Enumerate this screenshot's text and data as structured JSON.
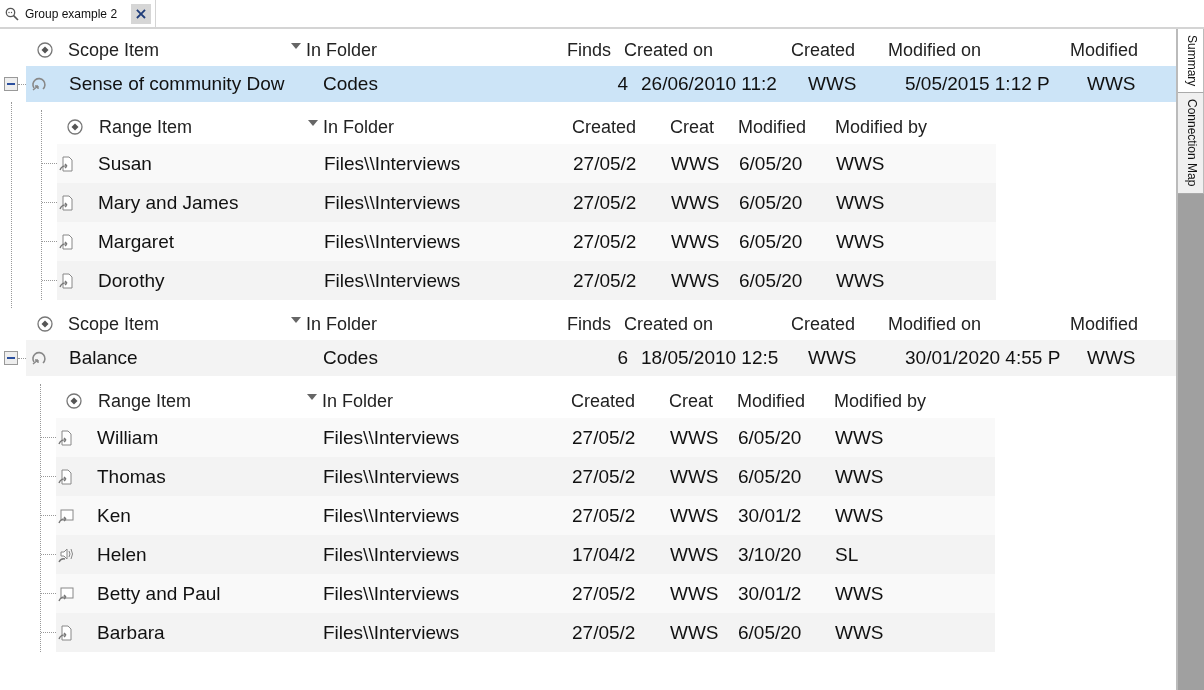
{
  "tab": {
    "title": "Group example 2",
    "close": "×"
  },
  "side_tabs": [
    {
      "label": "Summary",
      "selected": true
    },
    {
      "label": "Connection Map",
      "selected": false
    }
  ],
  "groups": [
    {
      "expanded": true,
      "columns": [
        "Scope Item",
        "In Folder",
        "Finds",
        "Created on",
        "Created",
        "Modified on",
        "Modified"
      ],
      "row": {
        "selected": true,
        "cells": [
          "Sense of community Dow",
          "Codes",
          "4",
          "26/06/2010 11:2",
          "WWS",
          "5/05/2015 1:12 P",
          "WWS"
        ]
      },
      "child_columns": [
        "Range Item",
        "In Folder",
        "Created",
        "Creat",
        "Modified",
        "Modified by"
      ],
      "children": [
        {
          "kind": "document",
          "cells": [
            "Susan",
            "Files\\\\Interviews",
            "27/05/2",
            "WWS",
            "6/05/20",
            "WWS"
          ]
        },
        {
          "kind": "document",
          "cells": [
            "Mary and James",
            "Files\\\\Interviews",
            "27/05/2",
            "WWS",
            "6/05/20",
            "WWS"
          ]
        },
        {
          "kind": "document",
          "cells": [
            "Margaret",
            "Files\\\\Interviews",
            "27/05/2",
            "WWS",
            "6/05/20",
            "WWS"
          ]
        },
        {
          "kind": "document",
          "cells": [
            "Dorothy",
            "Files\\\\Interviews",
            "27/05/2",
            "WWS",
            "6/05/20",
            "WWS"
          ]
        }
      ]
    },
    {
      "expanded": true,
      "columns": [
        "Scope Item",
        "In Folder",
        "Finds",
        "Created on",
        "Created",
        "Modified on",
        "Modified"
      ],
      "row": {
        "selected": false,
        "cells": [
          "Balance",
          "Codes",
          "6",
          "18/05/2010 12:5",
          "WWS",
          "30/01/2020 4:55 P",
          "WWS"
        ]
      },
      "child_columns": [
        "Range Item",
        "In Folder",
        "Created",
        "Creat",
        "Modified",
        "Modified by"
      ],
      "children": [
        {
          "kind": "document",
          "cells": [
            "William",
            "Files\\\\Interviews",
            "27/05/2",
            "WWS",
            "6/05/20",
            "WWS"
          ]
        },
        {
          "kind": "document",
          "cells": [
            "Thomas",
            "Files\\\\Interviews",
            "27/05/2",
            "WWS",
            "6/05/20",
            "WWS"
          ]
        },
        {
          "kind": "picture",
          "cells": [
            "Ken",
            "Files\\\\Interviews",
            "27/05/2",
            "WWS",
            "30/01/2",
            "WWS"
          ]
        },
        {
          "kind": "audio",
          "cells": [
            "Helen",
            "Files\\\\Interviews",
            "17/04/2",
            "WWS",
            "3/10/20",
            "SL"
          ]
        },
        {
          "kind": "picture",
          "cells": [
            "Betty and Paul",
            "Files\\\\Interviews",
            "27/05/2",
            "WWS",
            "30/01/2",
            "WWS"
          ]
        },
        {
          "kind": "document",
          "cells": [
            "Barbara",
            "Files\\\\Interviews",
            "27/05/2",
            "WWS",
            "6/05/20",
            "WWS"
          ]
        }
      ]
    }
  ]
}
